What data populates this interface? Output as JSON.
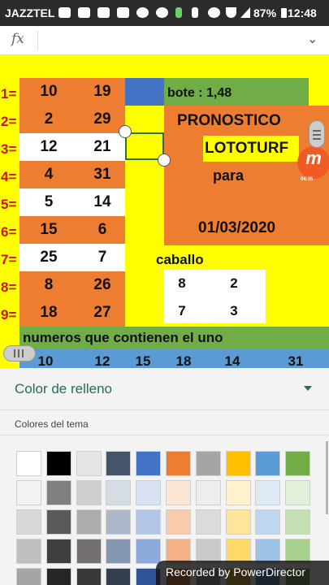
{
  "status_bar": {
    "carrier": "JAZZTEL",
    "battery": "87%",
    "time": "12:48",
    "icons": [
      "youtube-icon",
      "mail-icon",
      "facebook-icon",
      "mail-icon",
      "whatsapp-icon",
      "gear-icon",
      "walk-icon",
      "bluetooth-icon",
      "alarm-icon",
      "wifi-icon",
      "signal-icon",
      "battery-icon"
    ]
  },
  "formula_bar": {
    "fx_label": "fx",
    "value": ""
  },
  "sheet": {
    "row_labels": [
      "1=",
      "2=",
      "3=",
      "4=",
      "5=",
      "6=",
      "7=",
      "8=",
      "9="
    ],
    "rows": [
      {
        "a": "10",
        "b": "19"
      },
      {
        "a": "2",
        "b": "29"
      },
      {
        "a": "12",
        "b": "21"
      },
      {
        "a": "4",
        "b": "31"
      },
      {
        "a": "5",
        "b": "14"
      },
      {
        "a": "15",
        "b": "6"
      },
      {
        "a": "25",
        "b": "7"
      },
      {
        "a": "8",
        "b": "26"
      },
      {
        "a": "18",
        "b": "27"
      }
    ],
    "bote": "bote : 1,48",
    "pronostico": "PRONOSTICO",
    "lototurf": "LOTOTURF",
    "para": "para",
    "fecha": "01/03/2020",
    "caballo": "caballo",
    "caballo_rows": [
      [
        "8",
        "2"
      ],
      [
        "7",
        "3"
      ]
    ],
    "numeros_title": "numeros que  contienen el uno",
    "bottom_numbers": [
      "10",
      "12",
      "15",
      "18",
      "14",
      "31"
    ],
    "logo": {
      "letter": "m",
      "time": "04:35"
    }
  },
  "fill_panel": {
    "title": "Color de relleno",
    "section": "Colores del tema",
    "swatches": [
      [
        "#ffffff",
        "#000000",
        "#e7e6e6",
        "#44546a",
        "#4472c4",
        "#ed7d31",
        "#a5a5a5",
        "#ffc000",
        "#5b9bd5",
        "#70ad47"
      ],
      [
        "#f2f2f2",
        "#7f7f7f",
        "#d0cece",
        "#d6dce4",
        "#d9e2f3",
        "#fbe5d5",
        "#ededed",
        "#fff2cc",
        "#deebf6",
        "#e2efd9"
      ],
      [
        "#d8d8d8",
        "#595959",
        "#aeabab",
        "#adb9ca",
        "#b4c6e7",
        "#f7cbac",
        "#dbdbdb",
        "#fee599",
        "#bdd7ee",
        "#c5e0b3"
      ],
      [
        "#bfbfbf",
        "#3f3f3f",
        "#757070",
        "#8496b0",
        "#8eaadb",
        "#f4b183",
        "#c9c9c9",
        "#ffd965",
        "#9cc3e5",
        "#a8d08d"
      ],
      [
        "#a5a5a5",
        "#262626",
        "#3a3838",
        "#323f4f",
        "#2f5496",
        "#c55a11",
        "#7b7b7b",
        "#bf9000",
        "#2e75b5",
        "#538135"
      ]
    ]
  },
  "overlay": {
    "recorded": "Recorded by PowerDirector"
  }
}
